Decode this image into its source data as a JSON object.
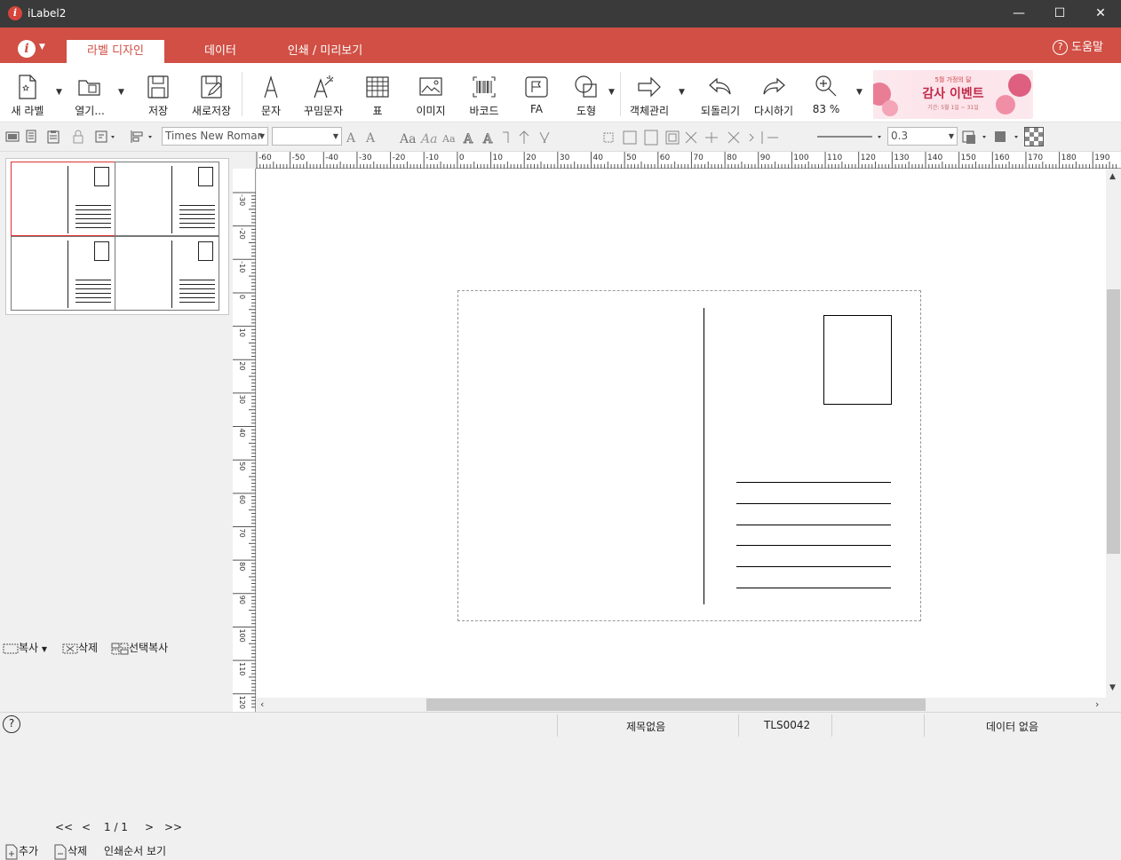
{
  "window": {
    "title": "iLabel2",
    "app_icon": "i"
  },
  "menu": {
    "info_icon": "i",
    "tabs": [
      "라벨 디자인",
      "데이터",
      "인쇄 / 미리보기"
    ],
    "active_tab": 0,
    "help": "도움말"
  },
  "toolbar": {
    "new_label": "새 라벨",
    "open": "열기...",
    "save": "저장",
    "save_as": "새로저장",
    "text": "문자",
    "fancy_text": "꾸밈문자",
    "table": "표",
    "image": "이미지",
    "barcode": "바코드",
    "fa": "FA",
    "shape": "도형",
    "object_manage": "객체관리",
    "undo": "되돌리기",
    "redo": "다시하기",
    "zoom": "83 %"
  },
  "banner": {
    "top_text": "5월 가정의 달",
    "title": "감사 이벤트",
    "sub_text": "기간: 5월 1일 ~ 31일"
  },
  "format_bar": {
    "font": "Times New Romar",
    "size": "",
    "line_width": "0.3"
  },
  "left_panel": {
    "copy": "복사",
    "delete": "삭제",
    "select_copy": "선택복사",
    "pager": {
      "first": "<<",
      "prev": "<",
      "page": "1 / 1",
      "next": ">",
      "last": ">>"
    },
    "add": "추가",
    "remove": "삭제",
    "print_order": "인쇄순서 보기"
  },
  "ruler_h": [
    "-60",
    "-50",
    "-40",
    "-30",
    "-20",
    "-10",
    "0",
    "10",
    "20",
    "30",
    "40",
    "50",
    "60",
    "70",
    "80",
    "90",
    "100",
    "110",
    "120",
    "130",
    "140",
    "150",
    "160",
    "170",
    "180",
    "190"
  ],
  "ruler_v": [
    "-30",
    "-20",
    "-10",
    "0",
    "10",
    "20",
    "30",
    "40",
    "50",
    "60",
    "70",
    "80",
    "90",
    "100",
    "110",
    "120"
  ],
  "status": {
    "title": "제목없음",
    "template": "TLS0042",
    "data": "데이터 없음"
  },
  "colors": {
    "accent": "#d14f44",
    "titlebar": "#3a3a3a"
  }
}
